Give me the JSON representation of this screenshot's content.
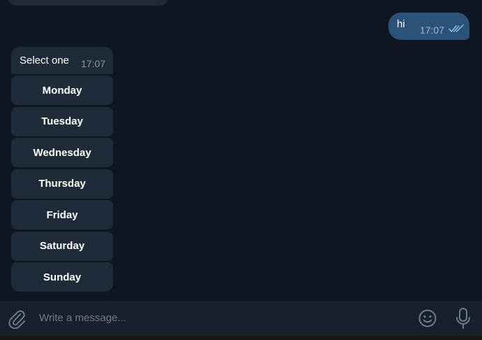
{
  "colors": {
    "background": "#0f1621",
    "outgoing_bubble": "#2b5278",
    "incoming_bubble": "#1f2a37",
    "keyboard_button": "#1f2b38",
    "composer": "#17212b",
    "read_ticks": "#8fb6e0"
  },
  "chat": {
    "outgoing": {
      "text": "hi",
      "time": "17:07",
      "status_icon": "double-check-icon"
    },
    "incoming": {
      "text": "Select one",
      "time": "17:07",
      "keyboard": [
        {
          "label": "Monday"
        },
        {
          "label": "Tuesday"
        },
        {
          "label": "Wednesday"
        },
        {
          "label": "Thursday"
        },
        {
          "label": "Friday"
        },
        {
          "label": "Saturday"
        },
        {
          "label": "Sunday"
        }
      ]
    }
  },
  "composer": {
    "placeholder": "Write a message...",
    "attach_icon": "paperclip-icon",
    "emoji_icon": "smiley-icon",
    "voice_icon": "microphone-icon"
  }
}
